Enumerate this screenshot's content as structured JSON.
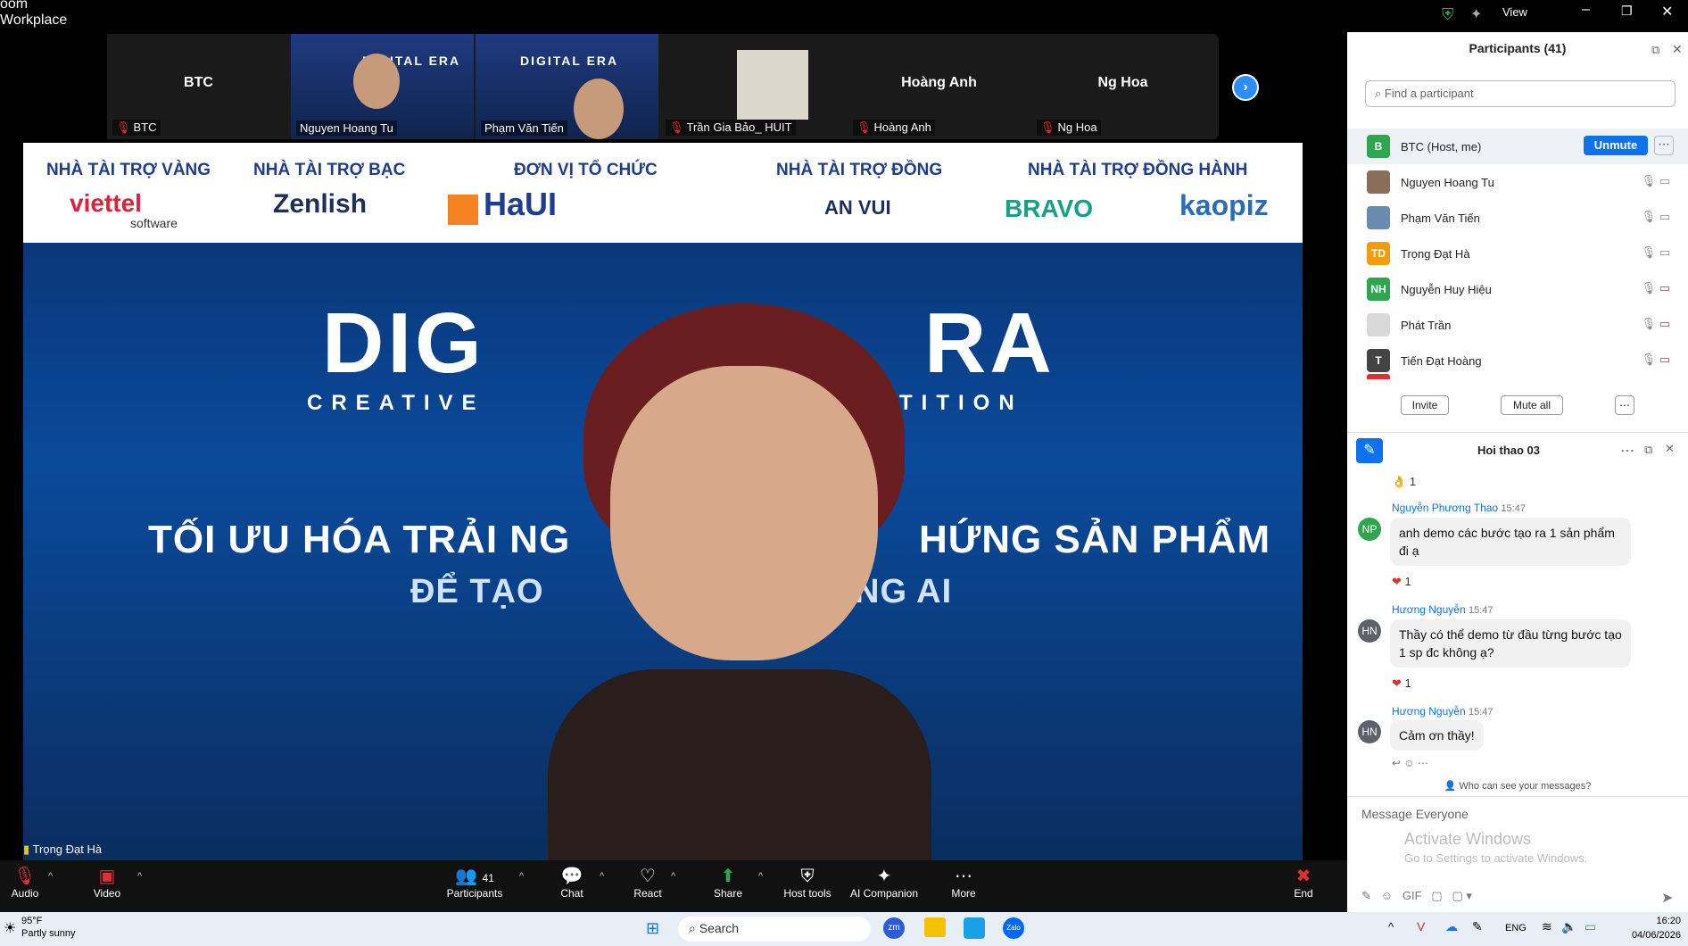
{
  "window": {
    "title": "oom\nWorkplace",
    "view_label": "View"
  },
  "strip": {
    "tiles": [
      {
        "name": "BTC",
        "label": "BTC"
      },
      {
        "name": "",
        "label": "Nguyen Hoang Tu"
      },
      {
        "name": "",
        "label": "Phạm Văn Tiến"
      },
      {
        "name": "",
        "label": "Trần Gia Bảo_ HUIT"
      },
      {
        "name": "Hoàng Anh",
        "label": "Hoàng Anh"
      },
      {
        "name": "Ng Hoa",
        "label": "Ng Hoa"
      }
    ],
    "tile_slide_title": "DIGITAL ERA"
  },
  "main": {
    "sponsors": [
      "NHÀ TÀI TRỢ VÀNG",
      "NHÀ TÀI TRỢ BẠC",
      "ĐƠN VỊ TỔ CHỨC",
      "NHÀ TÀI TRỢ ĐỒNG",
      "NHÀ TÀI TRỢ ĐỒNG HÀNH"
    ],
    "logos": {
      "viettel": "viettel",
      "viettel_sub": "software",
      "zenlish": "Zenlish",
      "haui": "HaUI",
      "anvui": "AN VUI",
      "bravo": "BRAVO",
      "kaopiz": "kaopiz"
    },
    "slide_title_left": "DIG",
    "slide_title_right": "RA",
    "slide_sub_left": "CREATIVE",
    "slide_sub_right": "PETITION",
    "line1_left": "TỐI ƯU HÓA TRẢI NG",
    "line1_right": "HỨNG SẢN PHẨM",
    "line2_left": "ĐỂ TẠO",
    "line2_right": "NG AI",
    "speaker": "Trọng Đạt Hà"
  },
  "toolbar": {
    "audio": "Audio",
    "video": "Video",
    "participants": "Participants",
    "participants_count": "41",
    "chat": "Chat",
    "react": "React",
    "share": "Share",
    "host_tools": "Host tools",
    "ai": "AI Companion",
    "more": "More",
    "end": "End"
  },
  "participants": {
    "title": "Participants (41)",
    "search_placeholder": "Find a participant",
    "unmute": "Unmute",
    "rows": [
      {
        "name": "BTC (Host, me)",
        "initials": "B",
        "color": "#2ea54f"
      },
      {
        "name": "Nguyen Hoang Tu",
        "initials": "",
        "color": "#8a6d5a"
      },
      {
        "name": "Phạm Văn Tiến",
        "initials": "",
        "color": "#6a8bb0"
      },
      {
        "name": "Trọng Đạt Hà",
        "initials": "TD",
        "color": "#f29d0e"
      },
      {
        "name": "Nguyễn Huy Hiệu",
        "initials": "NH",
        "color": "#2ea54f"
      },
      {
        "name": "Phát Trần",
        "initials": "",
        "color": "#d8d8d8"
      },
      {
        "name": "Tiến Đạt Hoàng",
        "initials": "T",
        "color": "#444"
      }
    ],
    "invite": "Invite",
    "mute_all": "Mute all"
  },
  "chat": {
    "title": "Hoi thao 03",
    "react0": "1",
    "m1_name": "Nguyễn Phương Thao",
    "m1_time": "15:47",
    "m1_initials": "NP",
    "m1_text": "anh demo các bước tạo ra 1 sản phẩm đi ạ",
    "m1_react": "1",
    "m2_name": "Hương Nguyễn",
    "m2_time": "15:47",
    "m2_initials": "HN",
    "m2_text": "Thầy có thể demo từ đầu từng bước tạo 1 sp đc không ạ?",
    "m2_react": "1",
    "m3_name": "Hương Nguyễn",
    "m3_time": "15:47",
    "m3_initials": "HN",
    "m3_text": "Cảm ơn thầy!",
    "who": "Who can see your messages?",
    "placeholder": "Message Everyone",
    "activate1": "Activate Windows",
    "activate2": "Go to Settings to activate Windows.",
    "gif": "GIF"
  },
  "taskbar": {
    "weather_temp": "95°F",
    "weather_desc": "Partly sunny",
    "search": "Search",
    "lang": "ENG",
    "time": "16:20",
    "date": "04/06/2026"
  }
}
